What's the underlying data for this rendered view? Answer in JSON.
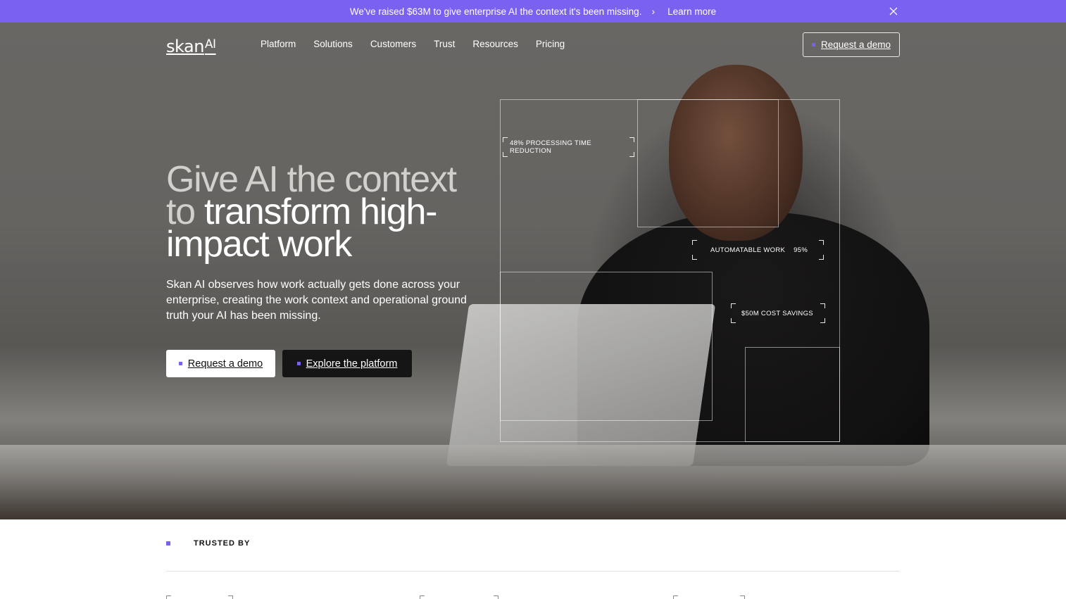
{
  "announcement": {
    "message": "We've raised $63M to give enterprise AI the context it's been missing.",
    "chevron": "›",
    "link_label": "Learn more",
    "close_icon": "close-icon",
    "background_color": "#7b61f0"
  },
  "nav": {
    "logo_text": "skan",
    "logo_suffix": "AI",
    "links": [
      "Platform",
      "Solutions",
      "Customers",
      "Trust",
      "Resources",
      "Pricing"
    ],
    "cta_label": "Request a demo"
  },
  "hero": {
    "headline_dim": "Give AI the context to",
    "headline_bright": "transform high-impact work",
    "subcopy": "Skan AI observes how work actually gets done across your enterprise, creating the work context and operational ground truth your AI has been missing.",
    "primary_button": "Request a demo",
    "secondary_button": "Explore the platform",
    "stats": {
      "processing": "48% PROCESSING TIME REDUCTION",
      "automatable_label": "AUTOMATABLE WORK",
      "automatable_value": "95%",
      "savings": "$50M COST SAVINGS"
    }
  },
  "trusted": {
    "label": "TRUSTED BY"
  },
  "accent_color": "#7b61f0"
}
